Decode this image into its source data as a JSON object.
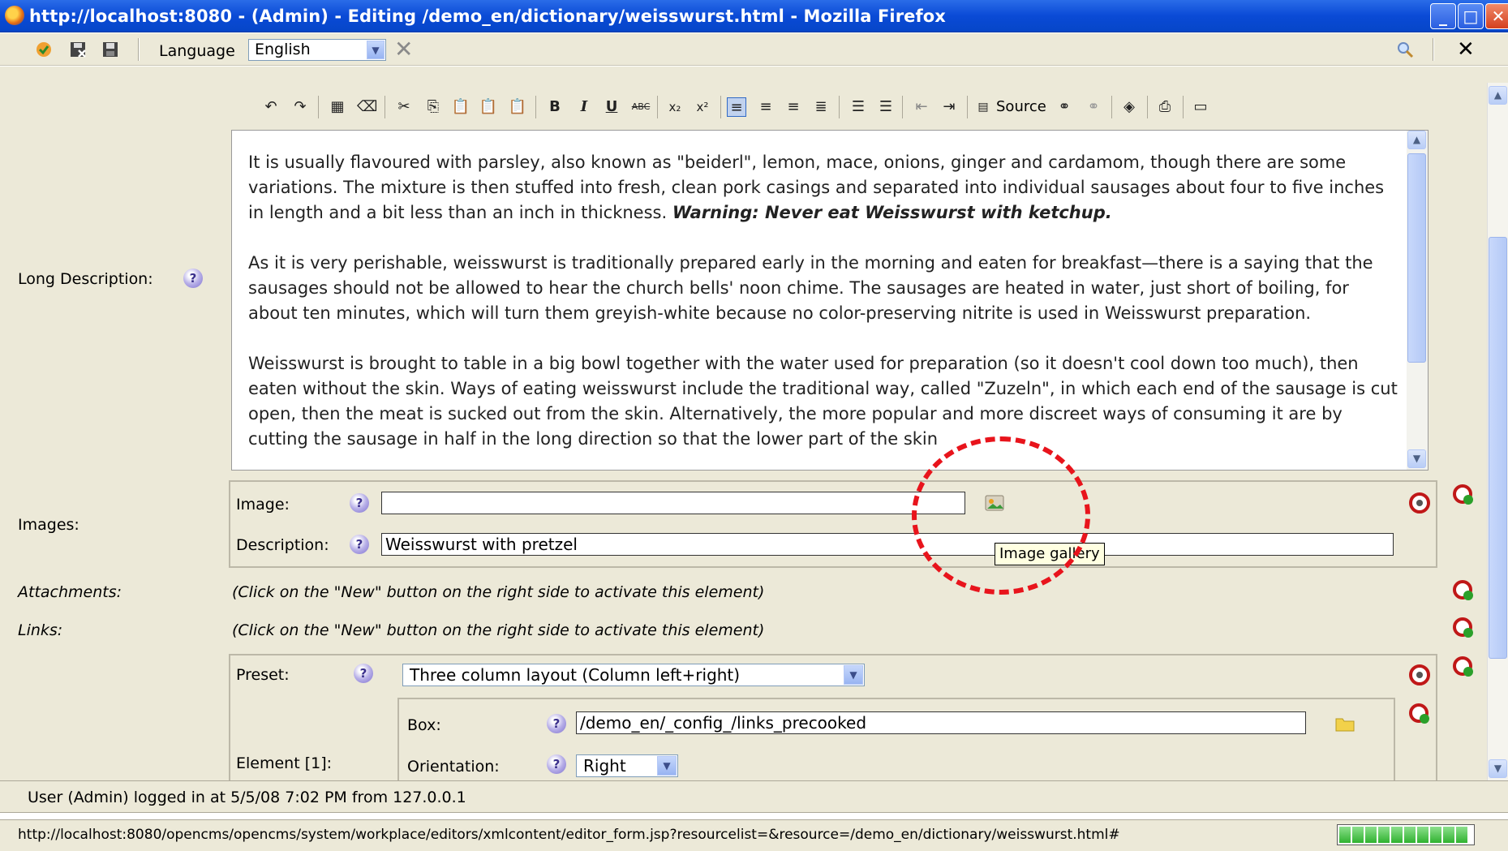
{
  "window": {
    "title": "http://localhost:8080 - (Admin) - Editing /demo_en/dictionary/weisswurst.html - Mozilla Firefox",
    "min_label": "_",
    "max_label": "□",
    "close_label": "✕"
  },
  "toolbar": {
    "language_label": "Language",
    "language_value": "English",
    "close_glyph": "✕",
    "clear_glyph": "✕"
  },
  "fields": {
    "long_description_label": "Long Description:",
    "images_label": "Images:",
    "image_label": "Image:",
    "image_value": "",
    "description_label": "Description:",
    "description_value": "Weisswurst with pretzel",
    "attachments_label": "Attachments:",
    "attachments_hint": "(Click on the \"New\" button on the right side to activate this element)",
    "links_label": "Links:",
    "links_hint": "(Click on the \"New\" button on the right side to activate this element)",
    "preset_label": "Preset:",
    "preset_value": "Three column layout (Column left+right)",
    "element_label": "Element [1]:",
    "box_label": "Box:",
    "box_value": "/demo_en/_config_/links_precooked",
    "orientation_label": "Orientation:",
    "orientation_value": "Right"
  },
  "editor": {
    "source_label": "Source",
    "paragraph1": "It is usually flavoured with parsley, also known as \"beiderl\", lemon, mace, onions, ginger and cardamom, though there are some variations. The mixture is then stuffed into fresh, clean pork casings and separated into individual sausages about four to five inches in length and a bit less than an inch in thickness.",
    "paragraph1_warning": "Warning: Never eat Weisswurst with ketchup.",
    "paragraph2": "As it is very perishable, weisswurst is traditionally prepared early in the morning and eaten for breakfast—there is a saying that the sausages should not be allowed to hear the church bells' noon chime. The sausages are heated in water, just short of boiling, for about ten minutes, which will turn them greyish-white because no color-preserving nitrite is used in Weisswurst preparation.",
    "paragraph3": "Weisswurst is brought to table in a big bowl together with the water used for preparation (so it doesn't cool down too much), then eaten without the skin. Ways of eating weisswurst include the traditional way, called \"Zuzeln\", in which each end of the sausage is cut open, then the meat is sucked out from the skin. Alternatively, the more popular and more discreet ways of consuming it are by cutting the sausage in half in the long direction so that the lower part of the skin"
  },
  "tooltip": "Image gallery",
  "status": {
    "login": "User (Admin) logged in at 5/5/08 7:02 PM from 127.0.0.1",
    "url": "http://localhost:8080/opencms/opencms/system/workplace/editors/xmlcontent/editor_form.jsp?resourcelist=&resource=/demo_en/dictionary/weisswurst.html#"
  },
  "colors": {
    "titlebar": "#0a4ad6",
    "chrome": "#ece9d8",
    "annotation": "#e8141c",
    "tooltip_bg": "#ffffe1"
  },
  "icons": {
    "help": "help-icon",
    "gallery": "image-gallery-icon",
    "folder": "folder-icon",
    "new": "new-element-icon",
    "search": "search-icon"
  },
  "help_glyph": "?"
}
